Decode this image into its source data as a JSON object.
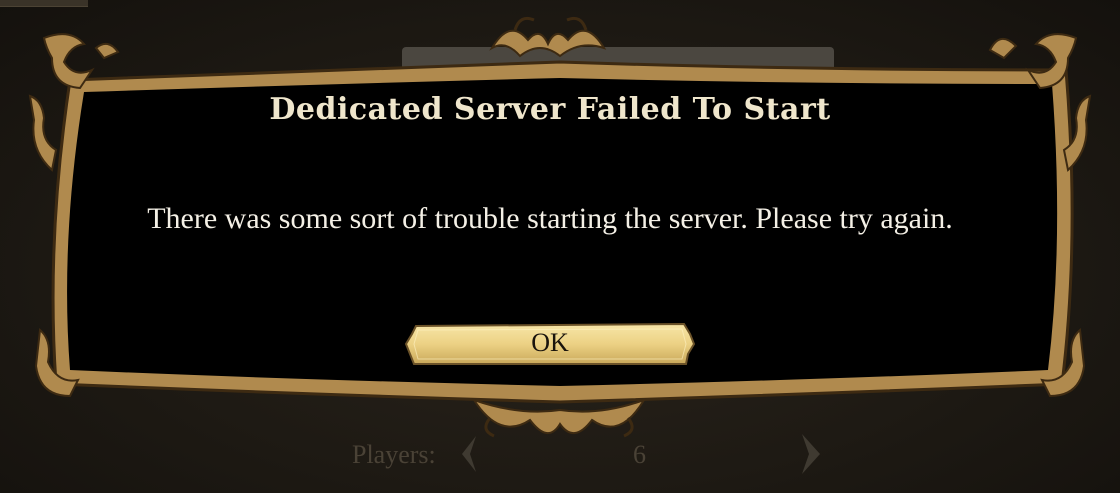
{
  "background": {
    "players_label": "Players:",
    "players_value": "6"
  },
  "dialog": {
    "title": "Dedicated Server Failed To Start",
    "message": "There was some sort of trouble starting the server. Please try again.",
    "ok_label": "OK"
  },
  "colors": {
    "frame_gold": "#b08a4e",
    "dialog_bg": "#000000",
    "button_gold": "#f0d890",
    "title_text": "#efe6cc"
  }
}
